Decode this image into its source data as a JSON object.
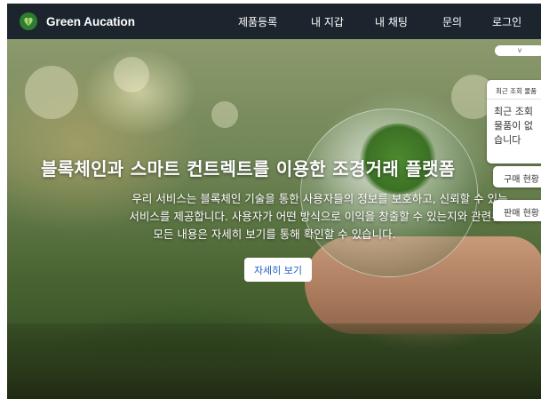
{
  "brand": {
    "name": "Green Aucation",
    "logo_icon": "leaf-heart-icon",
    "color": "#2e7d32"
  },
  "nav": {
    "items": [
      {
        "label": "제품등록"
      },
      {
        "label": "내 지갑"
      },
      {
        "label": "내 채팅"
      },
      {
        "label": "문의"
      },
      {
        "label": "로그인"
      }
    ],
    "background": "#1c252e"
  },
  "hero": {
    "title": "블록체인과 스마트 컨트렉트를 이용한 조경거래 플랫폼",
    "description_lines": [
      "우리 서비스는 블록체인 기술을 통한 사용자들의 정보를 보호하고, 신뢰할 수 있는",
      "서비스를 제공합니다. 사용자가 어떤 방식으로 이익을 창출할 수 있는지와 관련된",
      "모든 내용은 자세히 보기를 통해 확인할 수 있습니다."
    ],
    "cta_label": "자세히 보기",
    "cta_color": "#1f5fbf"
  },
  "sidebar": {
    "toggle_icon": "chevron-down-icon",
    "toggle_glyph": "v",
    "recent": {
      "header": "최근 조회 물품",
      "empty_lines": [
        "최근 조회",
        "물품이 없",
        "습니다"
      ]
    },
    "purchase_label": "구매 현황",
    "sale_label": "판매 현황"
  }
}
